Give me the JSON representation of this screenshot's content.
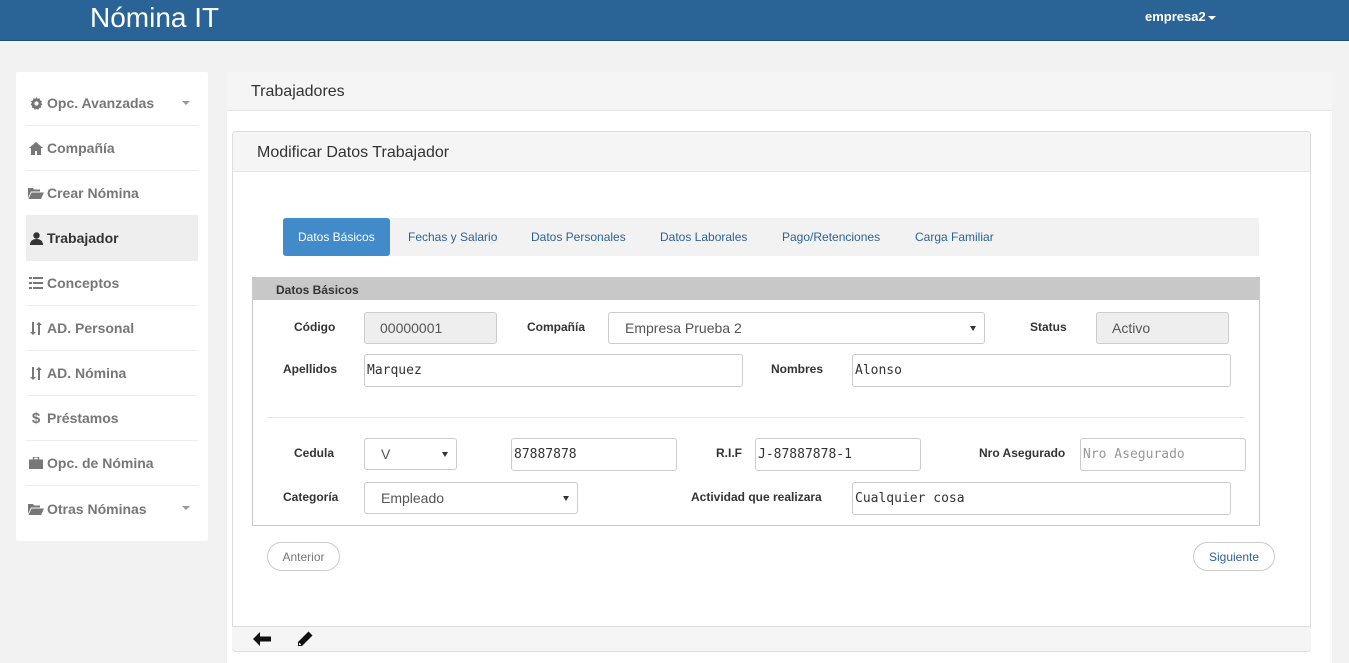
{
  "navbar": {
    "brand": "Nómina IT",
    "user": "empresa2"
  },
  "sidebar": {
    "items": [
      {
        "label": "Opc. Avanzadas",
        "icon": "gear-icon",
        "dropdown": true
      },
      {
        "label": "Compañía",
        "icon": "home-icon"
      },
      {
        "label": "Crear Nómina",
        "icon": "folder-open-icon"
      },
      {
        "label": "Trabajador",
        "icon": "user-icon",
        "active": true
      },
      {
        "label": "Conceptos",
        "icon": "list-icon"
      },
      {
        "label": "AD. Personal",
        "icon": "sort-icon"
      },
      {
        "label": "AD. Nómina",
        "icon": "sort-icon"
      },
      {
        "label": "Préstamos",
        "icon": "dollar-icon"
      },
      {
        "label": "Opc. de Nómina",
        "icon": "briefcase-icon"
      },
      {
        "label": "Otras Nóminas",
        "icon": "folder-open-icon",
        "dropdown": true
      }
    ]
  },
  "page": {
    "title": "Trabajadores"
  },
  "panel": {
    "title": "Modificar Datos Trabajador"
  },
  "tabs": [
    "Datos Básicos",
    "Fechas y Salario",
    "Datos Personales",
    "Datos Laborales",
    "Pago/Retenciones",
    "Carga Familiar"
  ],
  "form": {
    "legend": "Datos Básicos",
    "codigo": {
      "label": "Código",
      "value": "00000001"
    },
    "compania": {
      "label": "Compañía",
      "value": "Empresa Prueba 2"
    },
    "status": {
      "label": "Status",
      "value": "Activo"
    },
    "apellidos": {
      "label": "Apellidos",
      "value": "Marquez"
    },
    "nombres": {
      "label": "Nombres",
      "value": "Alonso"
    },
    "cedula": {
      "label": "Cedula",
      "type": "V",
      "value": "87887878"
    },
    "rif": {
      "label": "R.I.F",
      "value": "J-87887878-1"
    },
    "nro_asegurado": {
      "label": "Nro Asegurado",
      "placeholder": "Nro Asegurado"
    },
    "categoria": {
      "label": "Categoría",
      "value": "Empleado"
    },
    "actividad": {
      "label": "Actividad que realizara",
      "value": "Cualquier cosa"
    }
  },
  "buttons": {
    "prev": "Anterior",
    "next": "Siguiente"
  },
  "colors": {
    "navbar": "#2a6496",
    "accent": "#428bca"
  }
}
